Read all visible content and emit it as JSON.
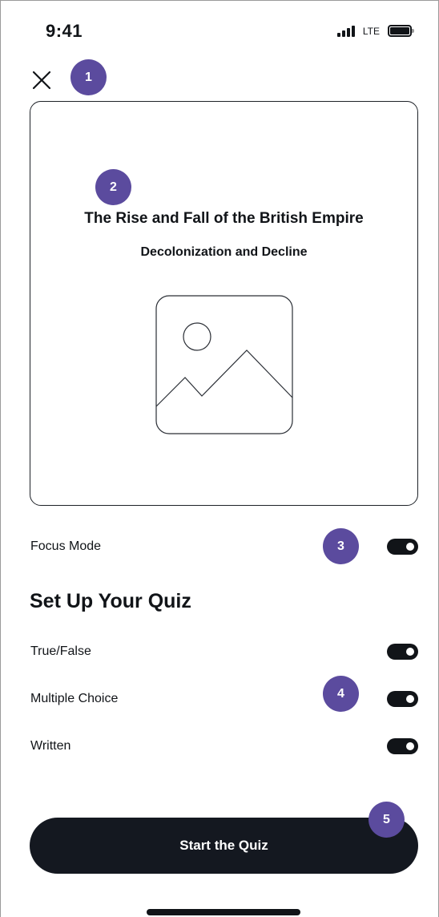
{
  "status_bar": {
    "time": "9:41",
    "network": "LTE",
    "signal_icon": "signal-bars-icon",
    "battery_icon": "battery-full-icon"
  },
  "header": {
    "close_icon": "close-icon"
  },
  "markers": [
    "1",
    "2",
    "3",
    "4",
    "5"
  ],
  "card": {
    "title": "The Rise and Fall of the British Empire",
    "subtitle": "Decolonization and Decline",
    "image_icon": "image-placeholder-icon"
  },
  "focus_mode": {
    "label": "Focus Mode",
    "enabled": true
  },
  "setup": {
    "title": "Set Up Your Quiz",
    "options": [
      {
        "label": "True/False",
        "enabled": true
      },
      {
        "label": "Multiple Choice",
        "enabled": true
      },
      {
        "label": "Written",
        "enabled": true
      }
    ]
  },
  "start_button": {
    "label": "Start the Quiz"
  },
  "colors": {
    "accent_marker": "#5b4b9e",
    "primary_dark": "#141820",
    "text": "#111418"
  }
}
